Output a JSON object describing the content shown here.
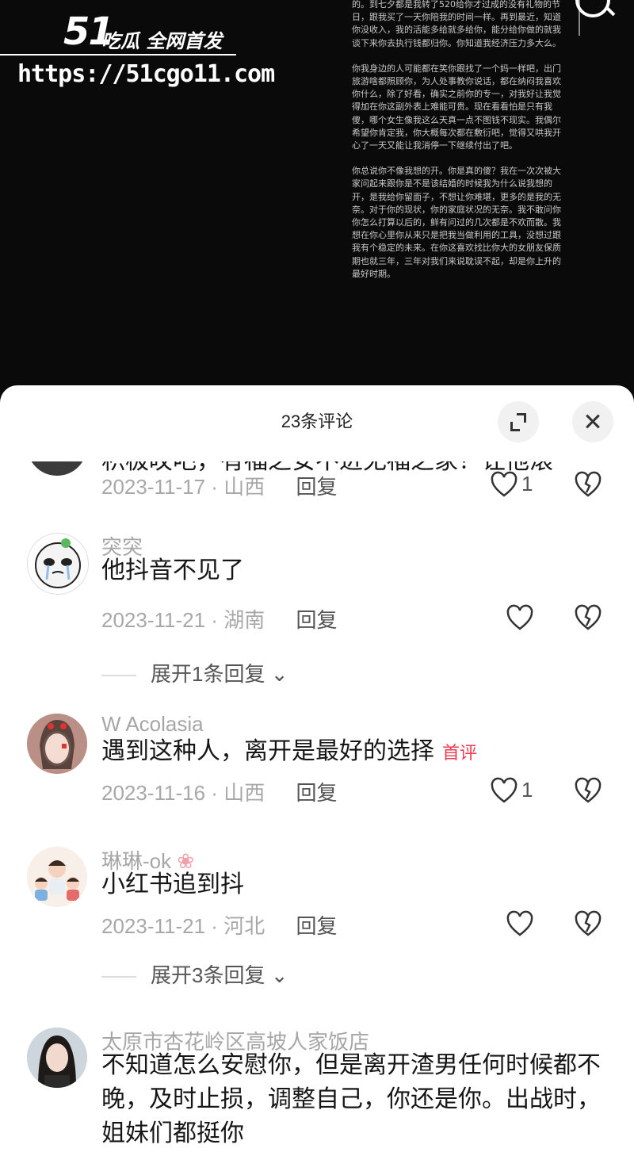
{
  "watermark": {
    "logo_number": "51",
    "logo_title": "吃瓜 全网首发",
    "url": "https://51cgo11.com"
  },
  "story": {
    "paragraphs": [
      "的。到七夕都是我转了520给你才过成的没有礼物的节日，跟我买了一天你陪我的时间一样。再到最近，知道你没收入，我的活能多给就多给你，能分给你做的就我谈下来你去执行钱都归你。你知道我经济压力多大么。",
      "你我身边的人可能都在笑你跟找了一个妈一样吧，出门旅游啥都照顾你，为人处事教你说话，都在纳闷我喜欢你什么，除了好看，确实之前你的专一，对我好让我觉得加在你这副外表上难能可贵。现在看看怕是只有我傻，哪个女生像我这么天真一点不图钱不现实。我偶尔希望你肯定我，你大概每次都在敷衍吧，觉得又哄我开心了一天又能让我消停一下继续付出了吧。",
      "你总说你不像我想的开。你是真的傻？我在一次次被大家问起来跟你是不是该结婚的时候我为什么说我想的开，是我给你留面子，不想让你难堪，更多的是我的无奈。对于你的现状，你的家庭状况的无奈。我不敢问你你怎么打算以后的，鲜有问过的几次都是不欢而散。我想在你心里你从来只是把我当做利用的工具，没想过跟我有个稳定的未来。在你这喜欢找比你大的女朋友保质期也就三年，三年对我们来说耽误不起，却是你上升的最好时期。"
    ]
  },
  "sheet": {
    "title": "23条评论"
  },
  "comments": [
    {
      "username": "",
      "text": "积极叹吧，有福之安不进无福之家！让他滚",
      "date": "2023-11-17",
      "location": "山西",
      "reply_label": "回复",
      "likes": "1"
    },
    {
      "username": "突突",
      "text": "他抖音不见了",
      "date": "2023-11-21",
      "location": "湖南",
      "reply_label": "回复",
      "likes": "",
      "expand": "展开1条回复"
    },
    {
      "username": "W Acolasia",
      "text": "遇到这种人，离开是最好的选择",
      "badge": "首评",
      "date": "2023-11-16",
      "location": "山西",
      "reply_label": "回复",
      "likes": "1"
    },
    {
      "username": "琳琳-ok",
      "text": "小红书追到抖",
      "date": "2023-11-21",
      "location": "河北",
      "reply_label": "回复",
      "likes": "",
      "expand": "展开3条回复"
    },
    {
      "username": "太原市杏花岭区高坡人家饭店",
      "text": "不知道怎么安慰你，但是离开渣男任何时候都不晚，及时止损，调整自己，你还是你。出战时，姐妹们都挺你"
    }
  ],
  "colors": {
    "badge": "#ee3b52",
    "meta": "#a8a8a8",
    "sheet": "#ffffff"
  },
  "icons": [
    "search-icon",
    "expand-icon",
    "close-icon",
    "heart-icon",
    "broken-heart-icon",
    "chevron-down-icon"
  ]
}
